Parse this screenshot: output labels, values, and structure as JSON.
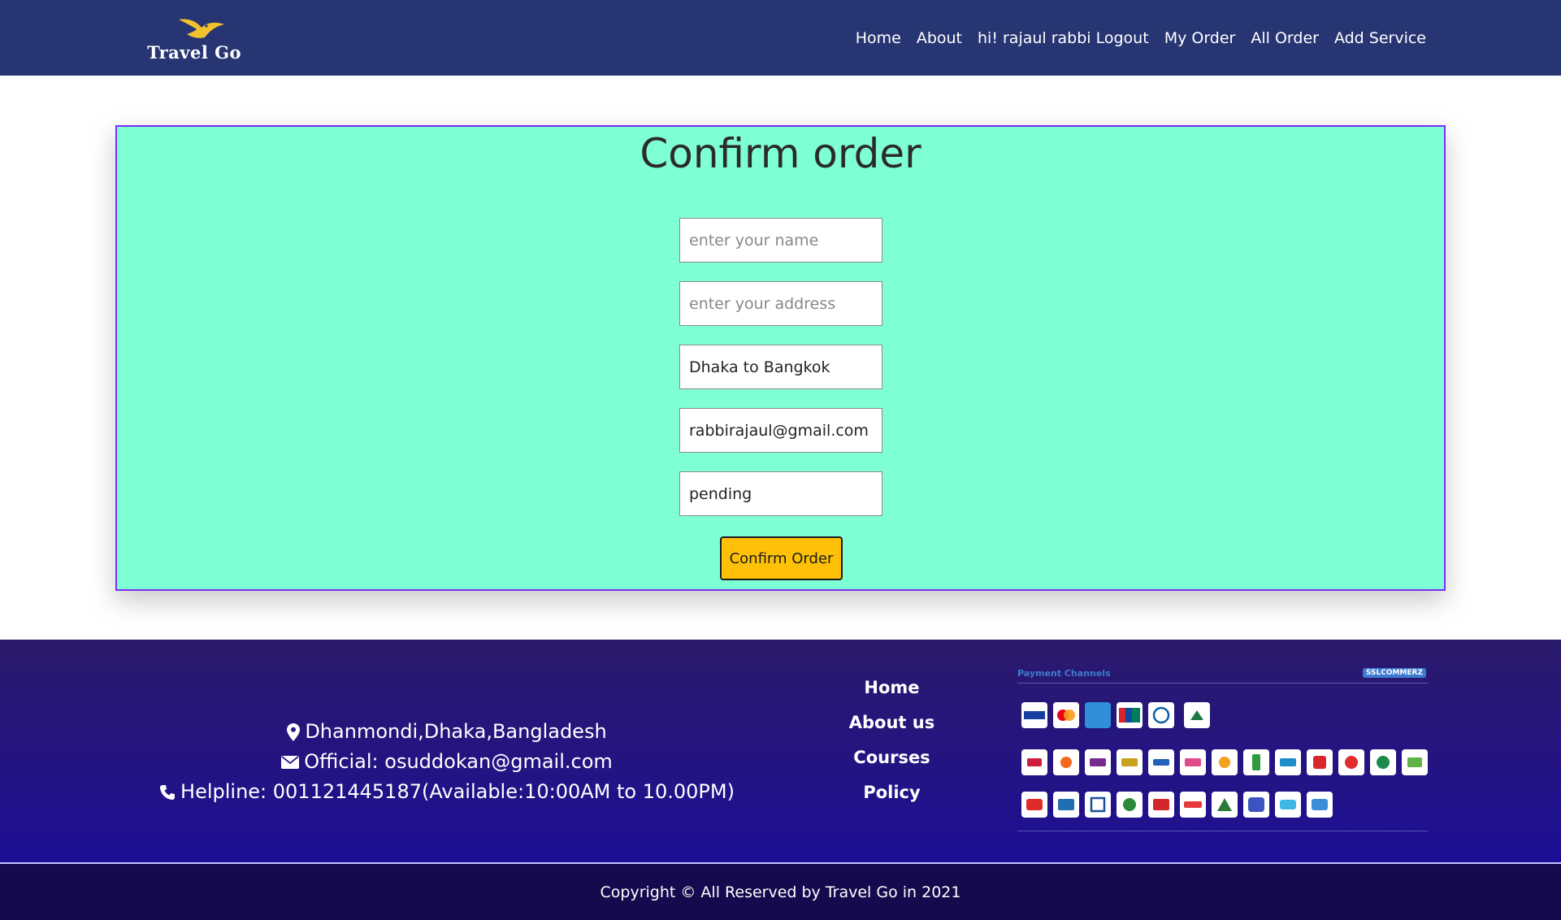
{
  "header": {
    "logo_text": "Travel Go",
    "nav": [
      "Home",
      "About",
      "hi! rajaul rabbi Logout",
      "My Order",
      "All Order",
      "Add Service"
    ]
  },
  "form": {
    "title": "Confirm order",
    "name_placeholder": "enter your name",
    "address_placeholder": "enter your address",
    "service_value": "Dhaka to Bangkok",
    "email_value": "rabbirajaul@gmail.com",
    "status_value": "pending",
    "submit_label": "Confirm Order"
  },
  "footer": {
    "address": "Dhanmondi,Dhaka,Bangladesh",
    "email": "Official: osuddokan@gmail.com",
    "helpline": "Helpline: 001121445187(Available:10:00AM to 10.00PM)",
    "links": [
      "Home",
      "About us",
      "Courses",
      "Policy"
    ],
    "payment_title": "Payment Channels",
    "payment_brand": "SSLCOMMERZ",
    "copyright": "Copyright © All Reserved by Travel Go in 2021"
  },
  "colors": {
    "navbar": "#273673",
    "card_bg": "#7fffd4",
    "card_border": "#7b2ff7",
    "button": "#ffc107",
    "footer_top": "#2b1a6b",
    "footer_bottom": "#1d0f95",
    "copyright_bg": "#150a4d"
  },
  "icons": {
    "logo": "bird-icon",
    "address": "map-marker-icon",
    "email": "envelope-icon",
    "helpline": "phone-icon"
  }
}
